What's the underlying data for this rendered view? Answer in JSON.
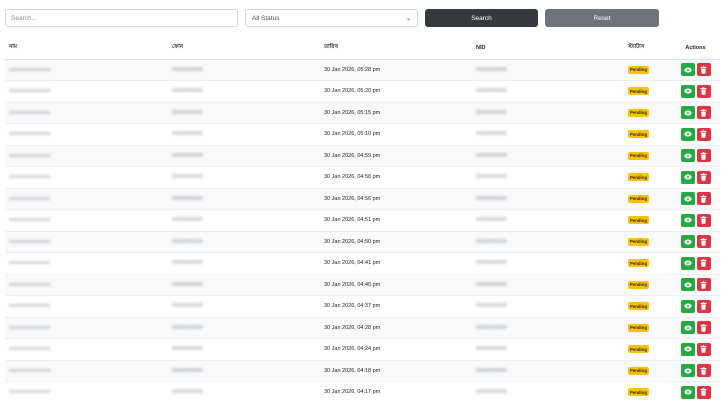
{
  "filters": {
    "search_placeholder": "Search...",
    "status_value": "All Status",
    "search_label": "Search",
    "reset_label": "Reset"
  },
  "table": {
    "columns": {
      "name": "নাম",
      "phone": "ফোন",
      "date": "তারিখ",
      "nid": "NID",
      "status": "স্ট্যাটাস",
      "actions": "Actions"
    },
    "rows": [
      {
        "date": "30 Jan 2026, 05:28 pm",
        "status": "Pending"
      },
      {
        "date": "30 Jan 2026, 05:20 pm",
        "status": "Pending"
      },
      {
        "date": "30 Jan 2026, 05:15 pm",
        "status": "Pending"
      },
      {
        "date": "30 Jan 2026, 05:10 pm",
        "status": "Pending"
      },
      {
        "date": "30 Jan 2026, 04:59 pm",
        "status": "Pending"
      },
      {
        "date": "30 Jan 2026, 04:58 pm",
        "status": "Pending"
      },
      {
        "date": "30 Jan 2026, 04:56 pm",
        "status": "Pending"
      },
      {
        "date": "30 Jan 2026, 04:51 pm",
        "status": "Pending"
      },
      {
        "date": "30 Jan 2026, 04:50 pm",
        "status": "Pending"
      },
      {
        "date": "30 Jan 2026, 04:41 pm",
        "status": "Pending"
      },
      {
        "date": "30 Jan 2026, 04:40 pm",
        "status": "Pending"
      },
      {
        "date": "30 Jan 2026, 04:37 pm",
        "status": "Pending"
      },
      {
        "date": "30 Jan 2026, 04:28 pm",
        "status": "Pending"
      },
      {
        "date": "30 Jan 2026, 04:24 pm",
        "status": "Pending"
      },
      {
        "date": "30 Jan 2026, 04:18 pm",
        "status": "Pending"
      },
      {
        "date": "30 Jan 2026, 04:17 pm",
        "status": "Pending"
      }
    ]
  },
  "icons": {
    "select_caret": "chevron-down-icon",
    "view": "eye-icon",
    "delete": "trash-icon"
  },
  "colors": {
    "search_button": "#343a40",
    "reset_button": "#6c757d",
    "pending_badge": "#ffc107",
    "view_button": "#28a745",
    "delete_button": "#dc3545"
  }
}
